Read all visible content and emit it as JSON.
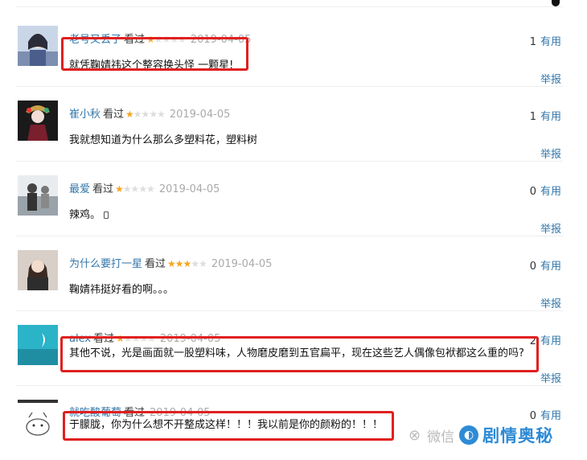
{
  "comments": [
    {
      "user": "老号又丢了",
      "status": "看过",
      "rating": 1,
      "date": "2019-04-05",
      "votes": "1",
      "vote_label": "有用",
      "text": "就凭鞠婧祎这个整容换头怪 一颗星!",
      "report": "举报",
      "highlighted": true
    },
    {
      "user": "崔小秋",
      "status": "看过",
      "rating": 1,
      "date": "2019-04-05",
      "votes": "1",
      "vote_label": "有用",
      "text": "我就想知道为什么那么多塑料花，塑料树",
      "report": "举报",
      "highlighted": false
    },
    {
      "user": "最爱",
      "status": "看过",
      "rating": 1,
      "date": "2019-04-05",
      "votes": "0",
      "vote_label": "有用",
      "text": "辣鸡。",
      "report": "举报",
      "highlighted": false
    },
    {
      "user": "为什么要打一星",
      "status": "看过",
      "rating": 3,
      "date": "2019-04-05",
      "votes": "0",
      "vote_label": "有用",
      "text": "鞠婧祎挺好看的啊。。。",
      "report": "举报",
      "highlighted": false
    },
    {
      "user": "alex",
      "status": "看过",
      "rating": 1,
      "date": "2019-04-05",
      "votes": "2",
      "vote_label": "有用",
      "text": "其他不说，光是画面就一股塑料味，人物磨皮磨到五官扁平，现在这些艺人偶像包袱都这么重的吗?",
      "report": "举报",
      "highlighted": true
    },
    {
      "user": "就吃酸葡萄",
      "status": "看过",
      "rating": 0,
      "date": "2019-04-05",
      "votes": "0",
      "vote_label": "有用",
      "text": "于朦胧，你为什么想不开整成这样！！！我以前是你的颜粉的！！！",
      "report": "",
      "highlighted": true
    }
  ],
  "watermark": {
    "wechat_label": "微信",
    "brand": "剧情奥秘"
  },
  "colors": {
    "link": "#3377aa",
    "star": "#f5a623",
    "highlight_border": "#e02020",
    "brand": "#2e8bd6"
  }
}
